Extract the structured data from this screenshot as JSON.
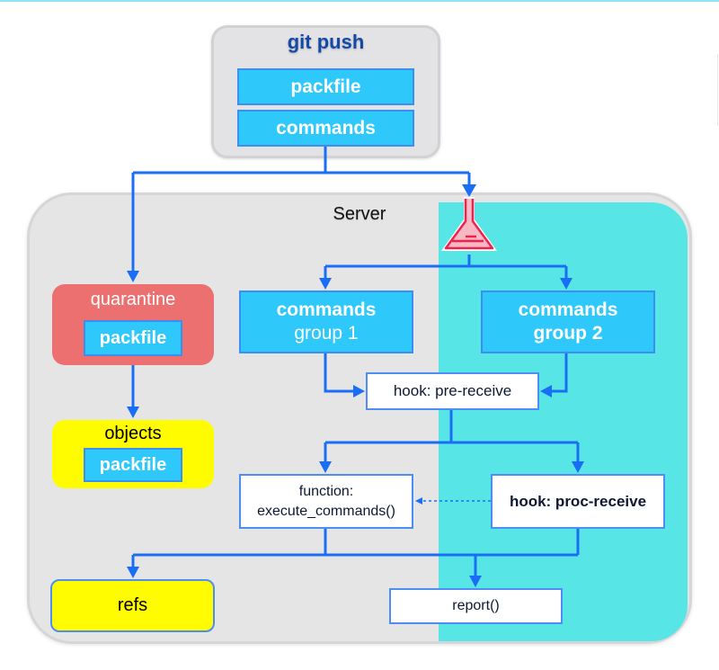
{
  "client": {
    "title": "git push",
    "items": [
      "packfile",
      "commands"
    ]
  },
  "server": {
    "label": "Server",
    "quarantine": {
      "label": "quarantine",
      "item": "packfile"
    },
    "objects": {
      "label": "objects",
      "item": "packfile"
    },
    "hook_icon": "flask-icon",
    "commands_group_1": {
      "line1": "commands",
      "line2": "group 1"
    },
    "commands_group_2": {
      "line1": "commands",
      "line2": "group 2"
    },
    "pre_receive": "hook: pre-receive",
    "execute_commands": {
      "line1": "function:",
      "line2": "execute_commands()"
    },
    "proc_receive": "hook: proc-receive",
    "refs": "refs",
    "report": "report()"
  },
  "colors": {
    "arrow": "#1a6ef5",
    "packet_blue": "#2ec8fb",
    "quarantine": "#ec7070",
    "objects_refs": "#fffc00",
    "proc_receive_region": "#57e5e5",
    "flask": "#f0214f"
  }
}
